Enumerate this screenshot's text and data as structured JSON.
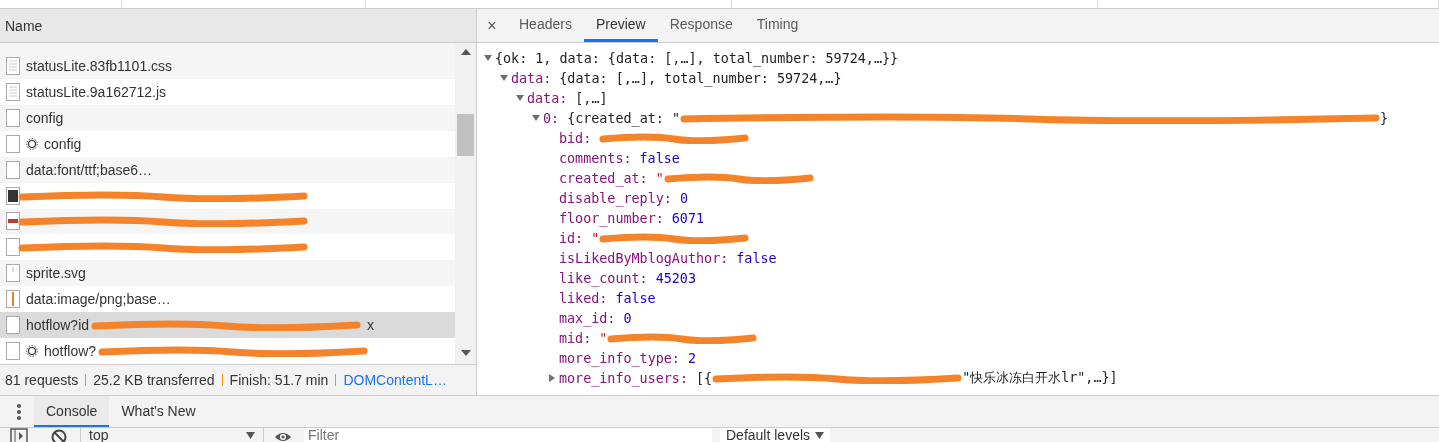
{
  "requests": {
    "header": "Name",
    "rows": [
      {
        "name": "statusLite.83fb1101.css",
        "kind": "document",
        "gear": false,
        "redacted": false,
        "selected": false
      },
      {
        "name": "statusLite.9a162712.js",
        "kind": "document",
        "gear": false,
        "redacted": false,
        "selected": false
      },
      {
        "name": "config",
        "kind": "blank",
        "gear": false,
        "redacted": false,
        "selected": false
      },
      {
        "name": "config",
        "kind": "blank",
        "gear": true,
        "redacted": false,
        "selected": false
      },
      {
        "name": "data:font/ttf;base6…",
        "kind": "blank",
        "gear": false,
        "redacted": false,
        "selected": false
      },
      {
        "kind": "photo",
        "gear": false,
        "redacted": true,
        "selected": false
      },
      {
        "kind": "banner",
        "gear": false,
        "redacted": true,
        "selected": false
      },
      {
        "kind": "blank",
        "gear": false,
        "redacted": true,
        "selected": false
      },
      {
        "name": "sprite.svg",
        "kind": "sprite",
        "gear": false,
        "redacted": false,
        "selected": false
      },
      {
        "name": "data:image/png;base…",
        "kind": "strip",
        "gear": false,
        "redacted": false,
        "selected": false
      },
      {
        "name": "hotflow?id",
        "kind": "blank",
        "gear": false,
        "redacted": true,
        "suffix": "x",
        "selected": true
      },
      {
        "name": "hotflow?",
        "kind": "blank",
        "gear": true,
        "redacted": true,
        "selected": false
      }
    ]
  },
  "summary": [
    {
      "text": "81 requests",
      "kind": "plain"
    },
    {
      "text": "25.2 KB transferred",
      "kind": "plain"
    },
    {
      "text": "Finish: 51.7 min",
      "kind": "plain"
    },
    {
      "text": "DOMContentL…",
      "kind": "link"
    }
  ],
  "detail_close": "×",
  "detail_tabs": [
    {
      "label": "Headers",
      "selected": false
    },
    {
      "label": "Preview",
      "selected": true
    },
    {
      "label": "Response",
      "selected": false
    },
    {
      "label": "Timing",
      "selected": false
    }
  ],
  "preview": {
    "lines": [
      {
        "value": "{ok: 1, data: {data: [,…], total_number: 59724,…}}",
        "kind": "object",
        "expanded": true,
        "children": [
          {
            "key": "data:",
            "value": "{data: [,…], total_number: 59724,…}",
            "kind": "object",
            "expanded": true,
            "children": [
              {
                "key": "data:",
                "value": "[,…]",
                "kind": "object",
                "expanded": true,
                "children": [
                  {
                    "key": "0:",
                    "value": "{created_at: \"",
                    "kind": "object",
                    "redacted": true,
                    "after": "}",
                    "expanded": true,
                    "children": [
                      {
                        "key": "bid:",
                        "redacted": true
                      },
                      {
                        "key": "comments:",
                        "value": "false",
                        "kind": "boolean",
                        "redacted": false
                      },
                      {
                        "key": "created_at:",
                        "value": "\"",
                        "kind": "string",
                        "redacted": true
                      },
                      {
                        "key": "disable_reply:",
                        "value": "0",
                        "kind": "number",
                        "redacted": false
                      },
                      {
                        "key": "floor_number:",
                        "value": "6071",
                        "kind": "number",
                        "redacted": false
                      },
                      {
                        "key": "id:",
                        "value": "\"",
                        "kind": "string",
                        "redacted": true
                      },
                      {
                        "key": "isLikedByMblogAuthor:",
                        "value": "false",
                        "kind": "boolean",
                        "redacted": false
                      },
                      {
                        "key": "like_count:",
                        "value": "45203",
                        "kind": "number",
                        "redacted": false
                      },
                      {
                        "key": "liked:",
                        "value": "false",
                        "kind": "boolean",
                        "redacted": false
                      },
                      {
                        "key": "max_id:",
                        "value": "0",
                        "kind": "number",
                        "redacted": false
                      },
                      {
                        "key": "mid:",
                        "value": "\"",
                        "kind": "string",
                        "redacted": true
                      },
                      {
                        "key": "more_info_type:",
                        "value": "2",
                        "kind": "number",
                        "redacted": false
                      },
                      {
                        "key": "more_info_users:",
                        "value": "[{",
                        "kind": "object",
                        "redacted": true,
                        "after": "\"快乐冰冻白开水lr\",…}]",
                        "expanded": false
                      }
                    ]
                  }
                ]
              }
            ]
          }
        ]
      }
    ]
  },
  "drawer": {
    "tabs": [
      {
        "label": "Console",
        "selected": true
      },
      {
        "label": "What's New",
        "selected": false
      }
    ],
    "context": "top",
    "filter": {
      "placeholder": "Filter"
    },
    "levels": "Default levels"
  }
}
